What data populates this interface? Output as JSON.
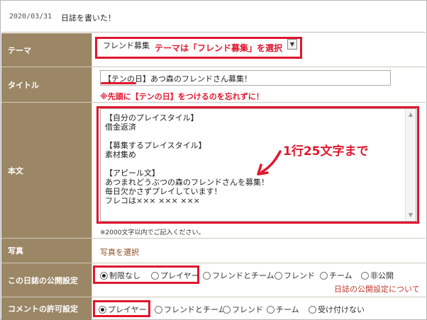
{
  "header": {
    "date": "2020/03/31",
    "title": "日誌を書いた！"
  },
  "theme": {
    "label": "テーマ",
    "selected": "フレンド募集",
    "annotation": "テーマは「フレンド募集」を選択"
  },
  "title_field": {
    "label": "タイトル",
    "value": "【テンの日】あつ森のフレンドさん募集！",
    "annotation": "※先頭に【テンの日】をつけるのを忘れずに！"
  },
  "body": {
    "label": "本文",
    "lines": [
      "【自分のプレイスタイル】",
      "借金返済",
      "",
      "【募集するプレイスタイル】",
      "素材集め",
      "",
      "【アピール文】",
      "あつまれどうぶつの森のフレンドさんを募集！",
      "毎日欠かさずプレイしています！",
      "フレコは××× ××× ×××"
    ],
    "annotation": "1行25文字まで",
    "note": "※2000文字以内でご記入ください。"
  },
  "photo": {
    "label": "写真",
    "link": "写真を選択"
  },
  "visibility": {
    "label": "この日誌の公開設定",
    "options": [
      {
        "label": "制限なし",
        "checked": true
      },
      {
        "label": "プレイヤー",
        "checked": false
      },
      {
        "label": "フレンドとチーム",
        "checked": false
      },
      {
        "label": "フレンド",
        "checked": false
      },
      {
        "label": "チーム",
        "checked": false
      },
      {
        "label": "非公開",
        "checked": false
      }
    ],
    "help_link": "日誌の公開設定について"
  },
  "comments": {
    "label": "コメントの許可設定",
    "options": [
      {
        "label": "プレイヤー",
        "checked": true
      },
      {
        "label": "フレンドとチーム",
        "checked": false
      },
      {
        "label": "フレンド",
        "checked": false
      },
      {
        "label": "チーム",
        "checked": false
      },
      {
        "label": "受け付けない",
        "checked": false
      }
    ]
  },
  "colors": {
    "label_bg": "#9b8766",
    "annotation_red": "#e0172e"
  }
}
